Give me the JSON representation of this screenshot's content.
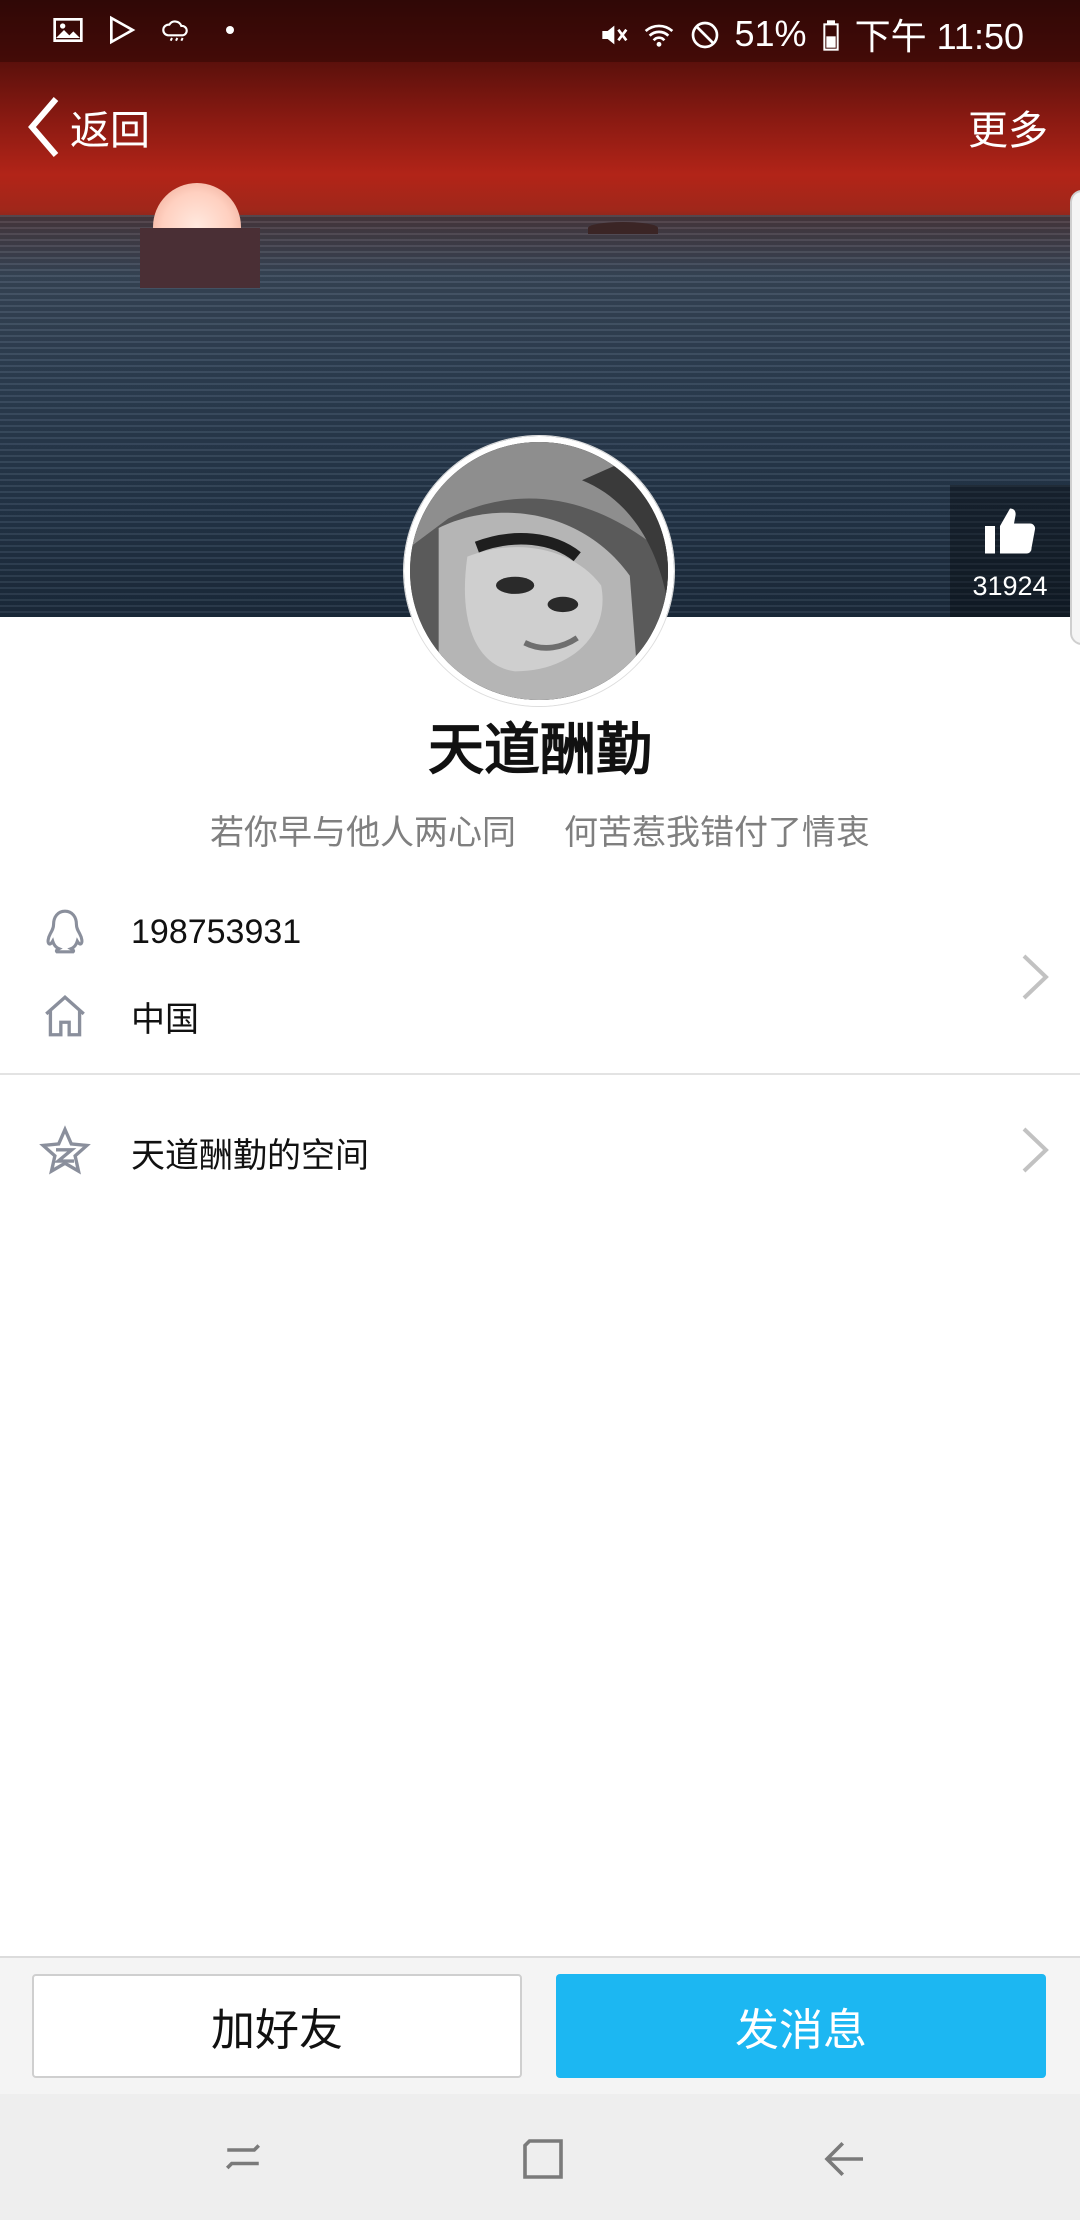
{
  "status_bar": {
    "icons_left": [
      "image-icon",
      "play-store-icon",
      "weather-cloud-icon",
      "dot-icon"
    ],
    "icons_right": [
      "mute-icon",
      "wifi-icon",
      "do-not-disturb-icon",
      "battery-icon"
    ],
    "battery": "51%",
    "time": "下午 11:50"
  },
  "header": {
    "back_label": "返回",
    "more_label": "更多"
  },
  "like": {
    "count": "31924"
  },
  "profile": {
    "name": "天道酬勤",
    "signature_part1": "若你早与他人两心同",
    "signature_part2": "何苦惹我错付了情衷"
  },
  "info": {
    "qq_number": "198753931",
    "location": "中国"
  },
  "space": {
    "label": "天道酬勤的空间"
  },
  "actions": {
    "add_friend": "加好友",
    "send_message": "发消息"
  },
  "colors": {
    "accent": "#1cb7f2",
    "icon_gray": "#8a8f9c"
  }
}
